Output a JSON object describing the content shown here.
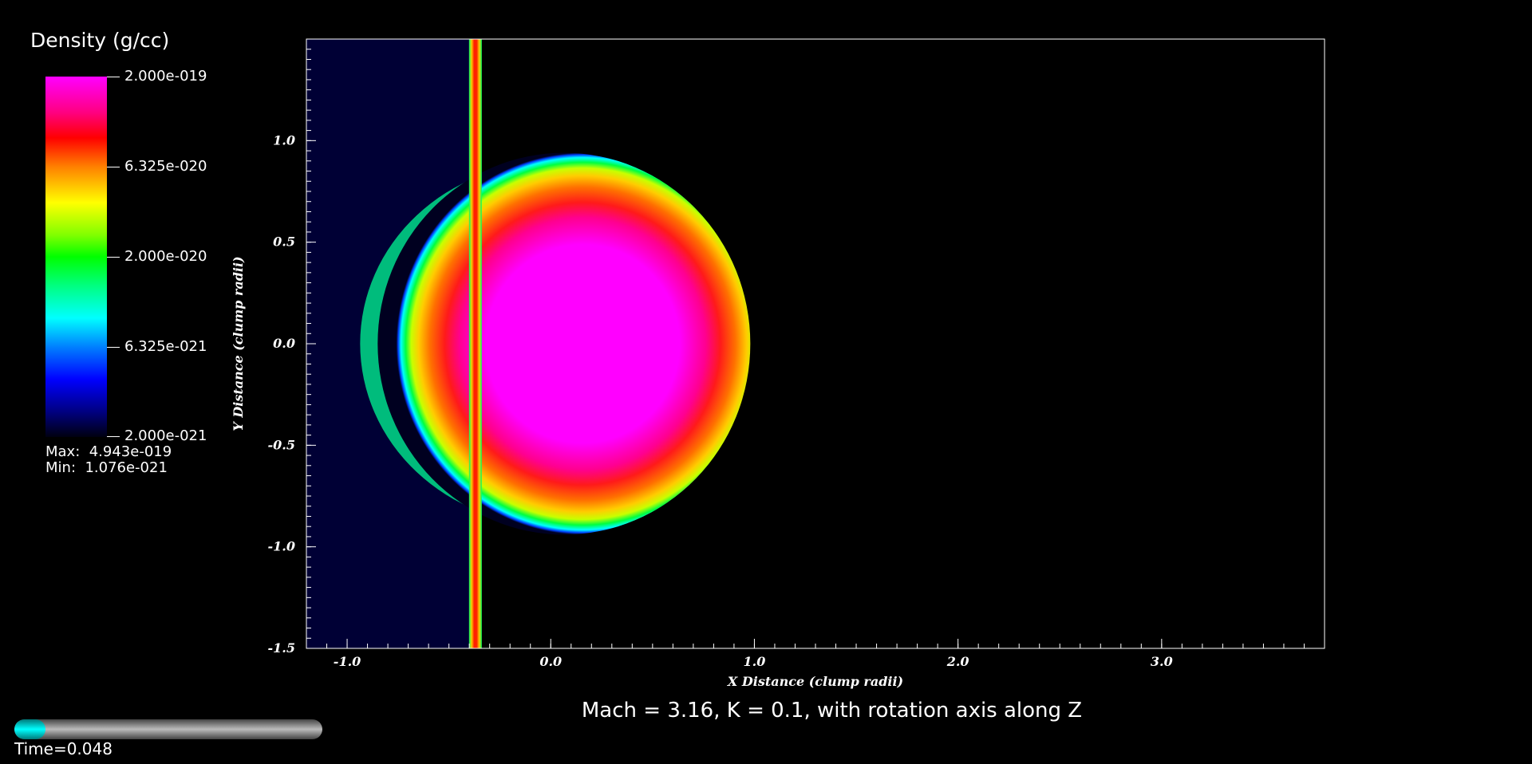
{
  "legend": {
    "title": "Density (g/cc)",
    "ticks": [
      "2.000e-019",
      "6.325e-020",
      "2.000e-020",
      "6.325e-021",
      "2.000e-021"
    ],
    "max_text": "Max:  4.943e-019",
    "min_text": "Min:  1.076e-021"
  },
  "caption": "Mach = 3.16, K = 0.1, with rotation axis along Z",
  "time": {
    "label": "Time=0.048",
    "progress": 0.1
  },
  "chart_data": {
    "type": "heatmap",
    "title": "Mach = 3.16, K = 0.1, with rotation axis along Z",
    "xlabel": "X Distance (clump radii)",
    "ylabel": "Y Distance (clump radii)",
    "xlim": [
      -1.2,
      3.8
    ],
    "ylim": [
      -1.5,
      1.5
    ],
    "x_ticks": [
      "-1.0",
      "0.0",
      "1.0",
      "2.0",
      "3.0"
    ],
    "y_ticks": [
      "1.0",
      "0.5",
      "0.0",
      "-0.5",
      "-1.0",
      "-1.5"
    ],
    "colorbar": {
      "scale": "log",
      "min": 2e-21,
      "max": 2e-19,
      "colormap": "hot-rainbow"
    },
    "features": {
      "clump": {
        "center": [
          0.0,
          0.0
        ],
        "x_extent": [
          -0.85,
          0.98
        ],
        "y_extent": [
          -0.94,
          0.94
        ]
      },
      "shock_front_x": -0.37,
      "upstream_region_x": [
        -1.2,
        -0.37
      ]
    }
  }
}
